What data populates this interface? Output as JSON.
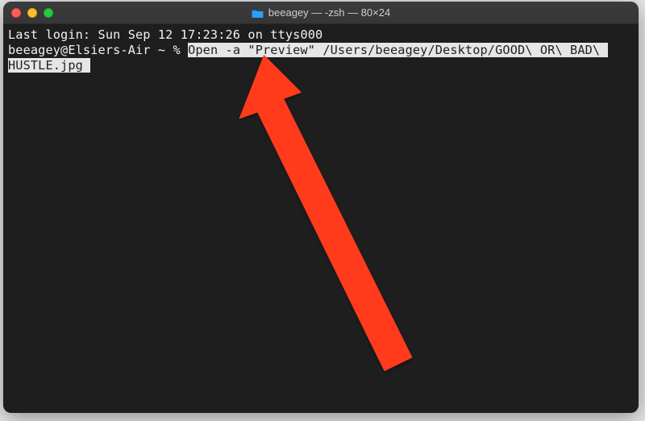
{
  "titlebar": {
    "icon": "folder-icon",
    "title": "beeagey — -zsh — 80×24"
  },
  "terminal": {
    "last_login": "Last login: Sun Sep 12 17:23:26 on ttys000",
    "prompt": "beeagey@Elsiers-Air ~ % ",
    "command_text": "Open -a \"Preview\" /Users/beeagey/Desktop/GOOD\\ OR\\ BAD\\ HUSTLE.jpg",
    "command_selected_part1": "Open -a \"Preview\" /Users/beeagey/Desktop/GOOD\\ OR\\ BAD\\ ",
    "command_selected_part2": "HUSTLE.jpg ",
    "colors": {
      "bg": "#1e1e1e",
      "fg": "#f2f2f2",
      "selection_bg": "#e6e6e6",
      "selection_fg": "#1f1f1f",
      "annotation_arrow": "#ff3b1f"
    }
  }
}
